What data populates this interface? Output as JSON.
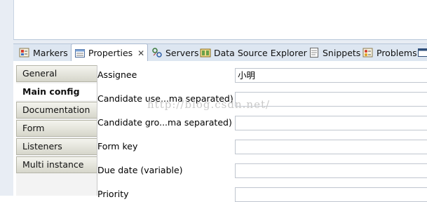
{
  "views": {
    "tabs": [
      {
        "label": "Markers",
        "icon": "markers-icon"
      },
      {
        "label": "Properties",
        "icon": "properties-icon",
        "active": true
      },
      {
        "label": "Servers",
        "icon": "servers-icon"
      },
      {
        "label": "Data Source Explorer",
        "icon": "data-source-explorer-icon"
      },
      {
        "label": "Snippets",
        "icon": "snippets-icon"
      },
      {
        "label": "Problems",
        "icon": "problems-icon"
      }
    ],
    "close_glyph": "✕"
  },
  "sidebar": {
    "items": [
      {
        "label": "General"
      },
      {
        "label": "Main config",
        "selected": true
      },
      {
        "label": "Documentation"
      },
      {
        "label": "Form"
      },
      {
        "label": "Listeners"
      },
      {
        "label": "Multi instance"
      }
    ]
  },
  "form": {
    "fields": [
      {
        "label": "Assignee",
        "value": "小明"
      },
      {
        "label": "Candidate use...ma separated)",
        "value": ""
      },
      {
        "label": "Candidate gro...ma separated)",
        "value": ""
      },
      {
        "label": "Form key",
        "value": ""
      },
      {
        "label": "Due date (variable)",
        "value": ""
      },
      {
        "label": "Priority",
        "value": ""
      }
    ]
  },
  "watermark": "http://blog.csdn.net/"
}
